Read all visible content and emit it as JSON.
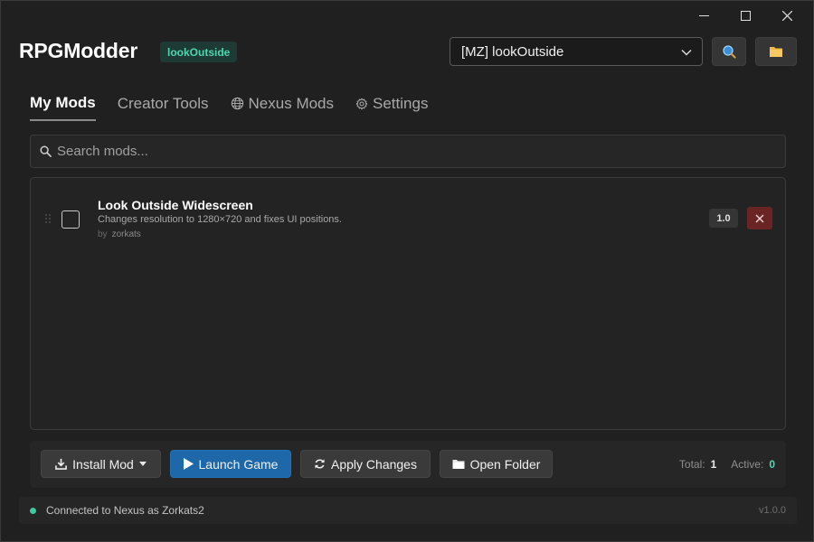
{
  "window": {
    "controls": {
      "minimize": "—",
      "maximize": "☐",
      "close": "✕"
    }
  },
  "header": {
    "app_title": "RPGModder",
    "game_badge": "lookOutside",
    "game_select": {
      "value": "[MZ] lookOutside"
    },
    "accent_color": "#4fd6b0"
  },
  "tabs": [
    {
      "label": "My Mods",
      "active": true,
      "icon": ""
    },
    {
      "label": "Creator Tools",
      "active": false,
      "icon": ""
    },
    {
      "label": "Nexus Mods",
      "active": false,
      "icon": "globe-icon"
    },
    {
      "label": "Settings",
      "active": false,
      "icon": "gear-icon"
    }
  ],
  "search": {
    "placeholder": "Search mods..."
  },
  "mods": [
    {
      "title": "Look Outside Widescreen",
      "description": "Changes resolution to 1280×720 and fixes UI positions.",
      "by_label": "by",
      "author": "zorkats",
      "version": "1.0",
      "enabled": false
    }
  ],
  "actions": {
    "install": "Install Mod",
    "launch": "Launch Game",
    "apply": "Apply Changes",
    "open_folder": "Open Folder"
  },
  "stats": {
    "total_label": "Total:",
    "total": "1",
    "active_label": "Active:",
    "active": "0"
  },
  "status": {
    "text": "Connected to Nexus as Zorkats2",
    "version": "v1.0.0",
    "color": "#3ec9a0"
  }
}
